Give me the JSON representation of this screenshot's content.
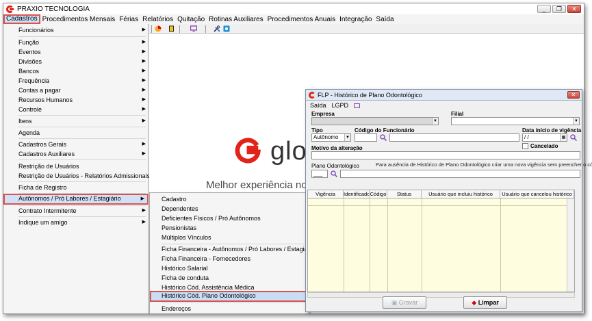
{
  "app": {
    "title": "PRAXIO TECNOLOGIA",
    "minimize": "_",
    "restore": "❐",
    "close": "✕"
  },
  "menubar": [
    "Cadastros",
    "Procedimentos Mensais",
    "Férias",
    "Relatórios",
    "Quitação",
    "Rotinas Auxiliares",
    "Procedimentos Anuais",
    "Integração",
    "Saída"
  ],
  "left_menu": {
    "items": [
      {
        "label": "Funcionários",
        "sub": true
      },
      {
        "label": "Função",
        "sub": true
      },
      {
        "label": "Eventos",
        "sub": true
      },
      {
        "label": "Divisões",
        "sub": true
      },
      {
        "label": "Bancos",
        "sub": true
      },
      {
        "label": "Frequência",
        "sub": true
      },
      {
        "label": "Contas a pagar",
        "sub": true
      },
      {
        "label": "Recursos Humanos",
        "sub": true
      },
      {
        "label": "Controle",
        "sub": true
      },
      {
        "label": "Itens",
        "sub": true
      },
      {
        "label": "Agenda",
        "sub": false
      },
      {
        "label": "Cadastros Gerais",
        "sub": true
      },
      {
        "label": "Cadastros Auxiliares",
        "sub": true
      },
      {
        "label": "Restrição de Usuários",
        "sub": false
      },
      {
        "label": "Restrição de Usuários - Relatórios Admissionais",
        "sub": false
      },
      {
        "label": "Ficha de Registro",
        "sub": false
      },
      {
        "label": "Autônomos / Pró Labores / Estagiário",
        "sub": true
      },
      {
        "label": "Contrato Intermitente",
        "sub": true
      },
      {
        "label": "Indique um amigo",
        "sub": true
      }
    ]
  },
  "toolbar": {
    "icons": [
      "pie-chart-icon",
      "door-exit-icon",
      "monitor-icon",
      "tools-icon",
      "help-icon"
    ],
    "collapse": "<<"
  },
  "brand": {
    "name": "glo",
    "slogan": "Melhor experiência no u"
  },
  "submenu": {
    "items": [
      "Cadastro",
      "Dependentes",
      "Deficientes Físicos / Pró Autônomos",
      "Pensionistas",
      "Múltiplos Vínculos",
      "Ficha Financeira - Autônomos / Pró Labores / Estagiário",
      "Ficha Financeira - Fornecedores",
      "Histórico Salarial",
      "Ficha de conduta",
      "Histórico Cód. Assistência Médica",
      "Histórico Cód. Plano Odontológico",
      "Endereços"
    ]
  },
  "dialog": {
    "title": "FLP - Histórico de Plano Odontológico",
    "menu": [
      "Saída",
      "LGPD"
    ],
    "close": "✕",
    "labels": {
      "empresa": "Empresa",
      "filial": "Filial",
      "tipo": "Tipo",
      "codigo": "Código do Funcionário",
      "data_inicio": "Data início de vigência",
      "cancelado": "Cancelado",
      "motivo": "Motivo da alteração",
      "plano": "Plano Odontológico",
      "hint": "Para ausência de Histórico de Plano Odontológico criar uma nova vigência sem preencher o código"
    },
    "values": {
      "tipo": "Autônomo",
      "data": " / /",
      "plano": "___"
    },
    "grid_columns": [
      "Vigência",
      "Identificador",
      "Código",
      "Status",
      "Usuário que incluiu histórico",
      "Usuário que cancelou histórico"
    ],
    "buttons": {
      "gravar": "Gravar",
      "limpar": "Limpar"
    }
  },
  "colors": {
    "accent_red": "#e2231a",
    "highlight": "#d9534f",
    "grid_bg": "#fffde0"
  }
}
